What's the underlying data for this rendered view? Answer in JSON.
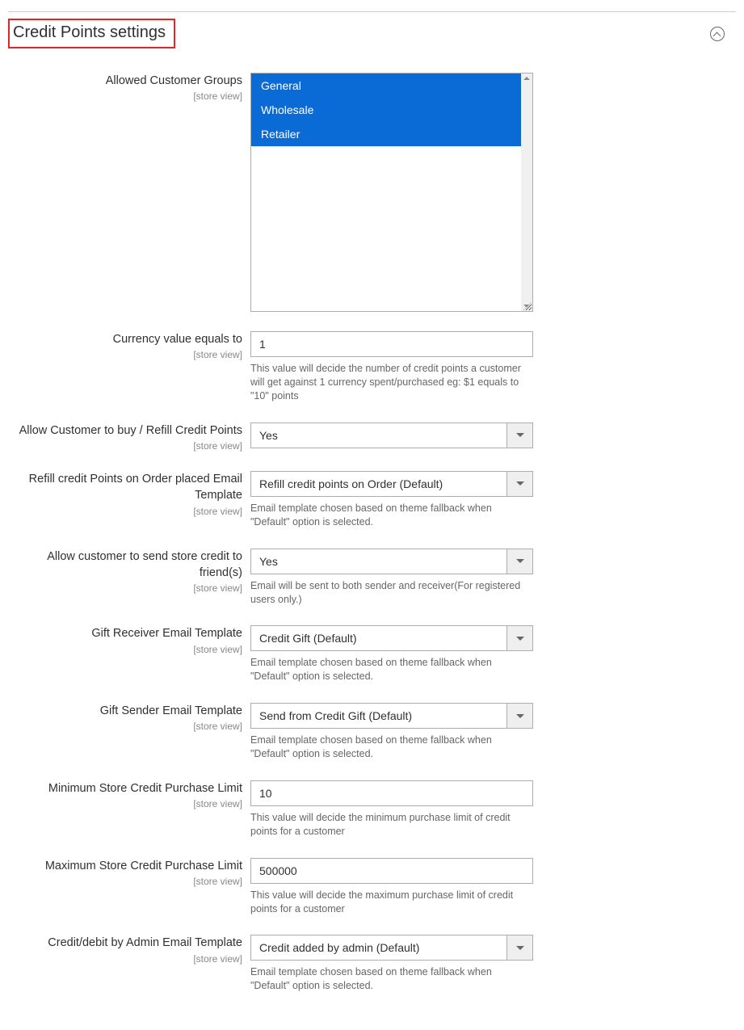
{
  "section": {
    "title": "Credit Points settings"
  },
  "scope_label": "[store view]",
  "customer_groups": {
    "label": "Allowed Customer Groups",
    "options": [
      "General",
      "Wholesale",
      "Retailer"
    ]
  },
  "currency_value": {
    "label": "Currency value equals to",
    "value": "1",
    "note": "This value will decide the number of credit points a customer will get against 1 currency spent/purchased eg: $1 equals to \"10\" points"
  },
  "allow_buy": {
    "label": "Allow Customer to buy / Refill Credit Points",
    "value": "Yes"
  },
  "refill_template": {
    "label": "Refill credit Points on Order placed Email Template",
    "value": "Refill credit points on Order (Default)",
    "note": "Email template chosen based on theme fallback when \"Default\" option is selected."
  },
  "allow_gift": {
    "label": "Allow customer to send store credit to friend(s)",
    "value": "Yes",
    "note": "Email will be sent to both sender and receiver(For registered users only.)"
  },
  "gift_receiver": {
    "label": "Gift Receiver Email Template",
    "value": "Credit Gift (Default)",
    "note": "Email template chosen based on theme fallback when \"Default\" option is selected."
  },
  "gift_sender": {
    "label": "Gift Sender Email Template",
    "value": "Send from Credit Gift (Default)",
    "note": "Email template chosen based on theme fallback when \"Default\" option is selected."
  },
  "min_limit": {
    "label": "Minimum Store Credit Purchase Limit",
    "value": "10",
    "note": "This value will decide the minimum purchase limit of credit points for a customer"
  },
  "max_limit": {
    "label": "Maximum Store Credit Purchase Limit",
    "value": "500000",
    "note": "This value will decide the maximum purchase limit of credit points for a customer"
  },
  "admin_template": {
    "label": "Credit/debit by Admin Email Template",
    "value": "Credit added by admin (Default)",
    "note": "Email template chosen based on theme fallback when \"Default\" option is selected."
  }
}
